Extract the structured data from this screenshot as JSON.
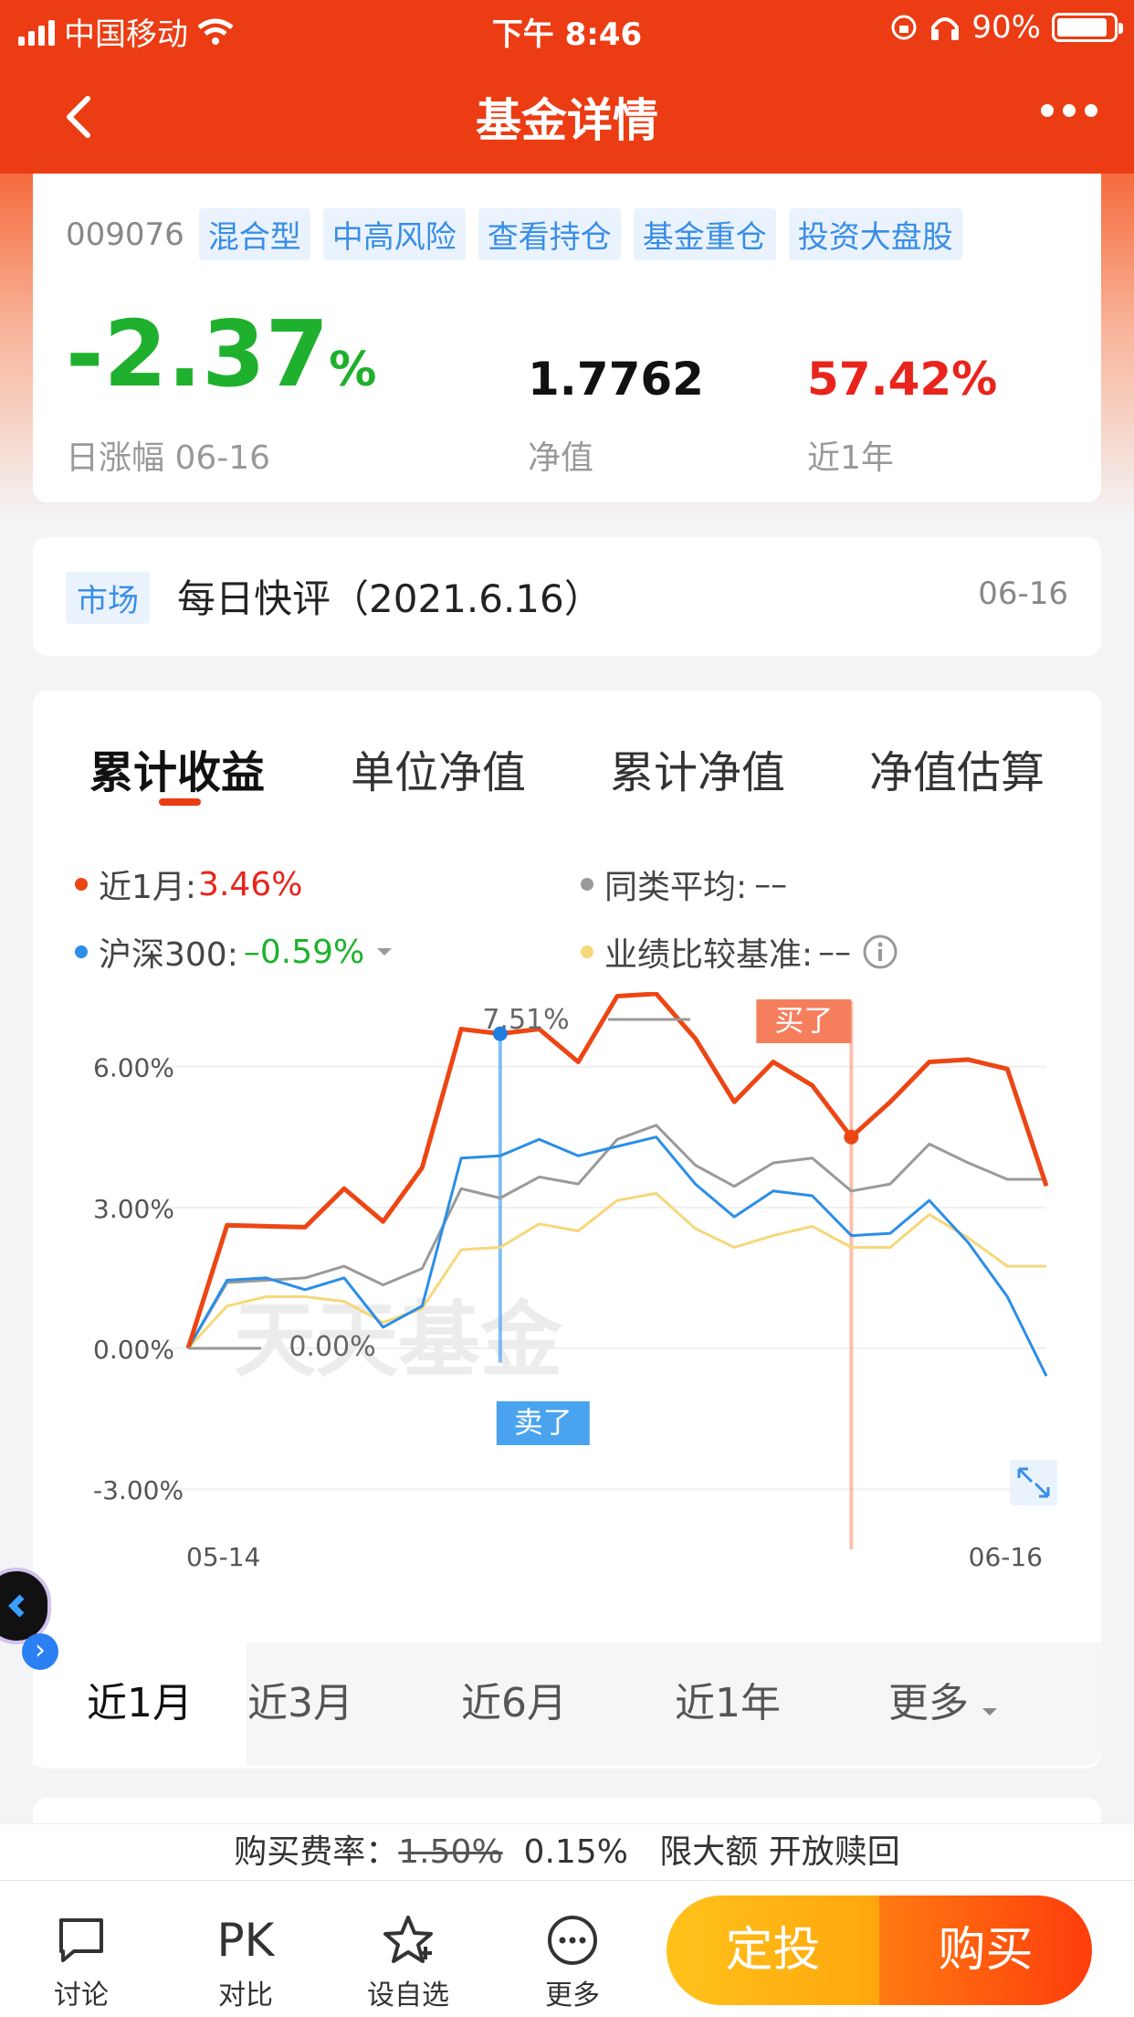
{
  "status_bar": {
    "carrier": "中国移动",
    "time": "下午 8:46",
    "battery": "90%"
  },
  "nav": {
    "title": "基金详情"
  },
  "fund": {
    "code": "009076",
    "tags": [
      "混合型",
      "中高风险",
      "查看持仓",
      "基金重仓",
      "投资大盘股"
    ],
    "daily_change_value": "-2.37",
    "daily_change_unit": "%",
    "daily_change_label": "日涨幅 06-16",
    "nav_value": "1.7762",
    "nav_label": "净值",
    "year_return_value": "57.42%",
    "year_return_label": "近1年"
  },
  "news": {
    "tag": "市场",
    "title": "每日快评（2021.6.16）",
    "date": "06-16"
  },
  "chart_tabs": [
    "累计收益",
    "单位净值",
    "累计净值",
    "净值估算"
  ],
  "legend": {
    "fund_label": "近1月:",
    "fund_value": "3.46%",
    "hs300_label": "沪深300:",
    "hs300_value": "–0.59%",
    "peer_label": "同类平均:",
    "peer_value": "––",
    "bench_label": "业绩比较基准:",
    "bench_value": "––"
  },
  "colors": {
    "fund": "#ec4614",
    "hs300": "#2a8ee8",
    "peer": "#9a9a9a",
    "bench": "#f6d77a",
    "up": "#e8241c",
    "down": "#1fb12e"
  },
  "chart_data": {
    "type": "line",
    "y_tick_labels": [
      "6.00%",
      "3.00%",
      "0.00%",
      "-3.00%"
    ],
    "ylim": [
      -3,
      6
    ],
    "x_tick_labels": [
      "05-14",
      "06-16"
    ],
    "watermark": "天天基金",
    "annotations": {
      "max_label": "7.51%",
      "start_label": "0.00%",
      "sell_label": "卖了",
      "buy_label": "买了"
    },
    "series": [
      {
        "name": "近1月",
        "values": [
          0,
          2.62,
          2.6,
          2.58,
          3.4,
          2.7,
          3.85,
          6.8,
          6.7,
          6.8,
          6.1,
          7.5,
          7.55,
          6.6,
          5.25,
          6.1,
          5.6,
          4.5,
          5.25,
          6.1,
          6.15,
          5.95,
          3.46
        ]
      },
      {
        "name": "沪深300",
        "values": [
          0,
          1.45,
          1.5,
          1.25,
          1.5,
          0.45,
          0.9,
          4.05,
          4.1,
          4.45,
          4.1,
          4.3,
          4.5,
          3.5,
          2.8,
          3.35,
          3.25,
          2.4,
          2.45,
          3.15,
          2.25,
          1.1,
          -0.59
        ]
      },
      {
        "name": "同类平均",
        "values": [
          0,
          1.4,
          1.45,
          1.5,
          1.75,
          1.35,
          1.7,
          3.4,
          3.2,
          3.65,
          3.5,
          4.45,
          4.75,
          3.9,
          3.45,
          3.95,
          4.05,
          3.35,
          3.5,
          4.35,
          3.95,
          3.6,
          3.6
        ]
      },
      {
        "name": "业绩比较基准",
        "values": [
          0,
          0.9,
          1.1,
          1.1,
          1.0,
          0.55,
          0.85,
          2.1,
          2.15,
          2.65,
          2.5,
          3.15,
          3.3,
          2.55,
          2.15,
          2.4,
          2.6,
          2.15,
          2.15,
          2.85,
          2.35,
          1.75,
          1.75
        ]
      }
    ]
  },
  "periods": [
    "近1月",
    "近3月",
    "近6月",
    "近1年",
    "更多"
  ],
  "fee": {
    "label": "购买费率：",
    "original": "1.50%",
    "current": "0.15%",
    "note": "限大额 开放赎回"
  },
  "bottom": {
    "discuss": "讨论",
    "pk_icon": "PK",
    "compare": "对比",
    "watch": "设自选",
    "more": "更多",
    "fixed_invest": "定投",
    "buy": "购买"
  }
}
